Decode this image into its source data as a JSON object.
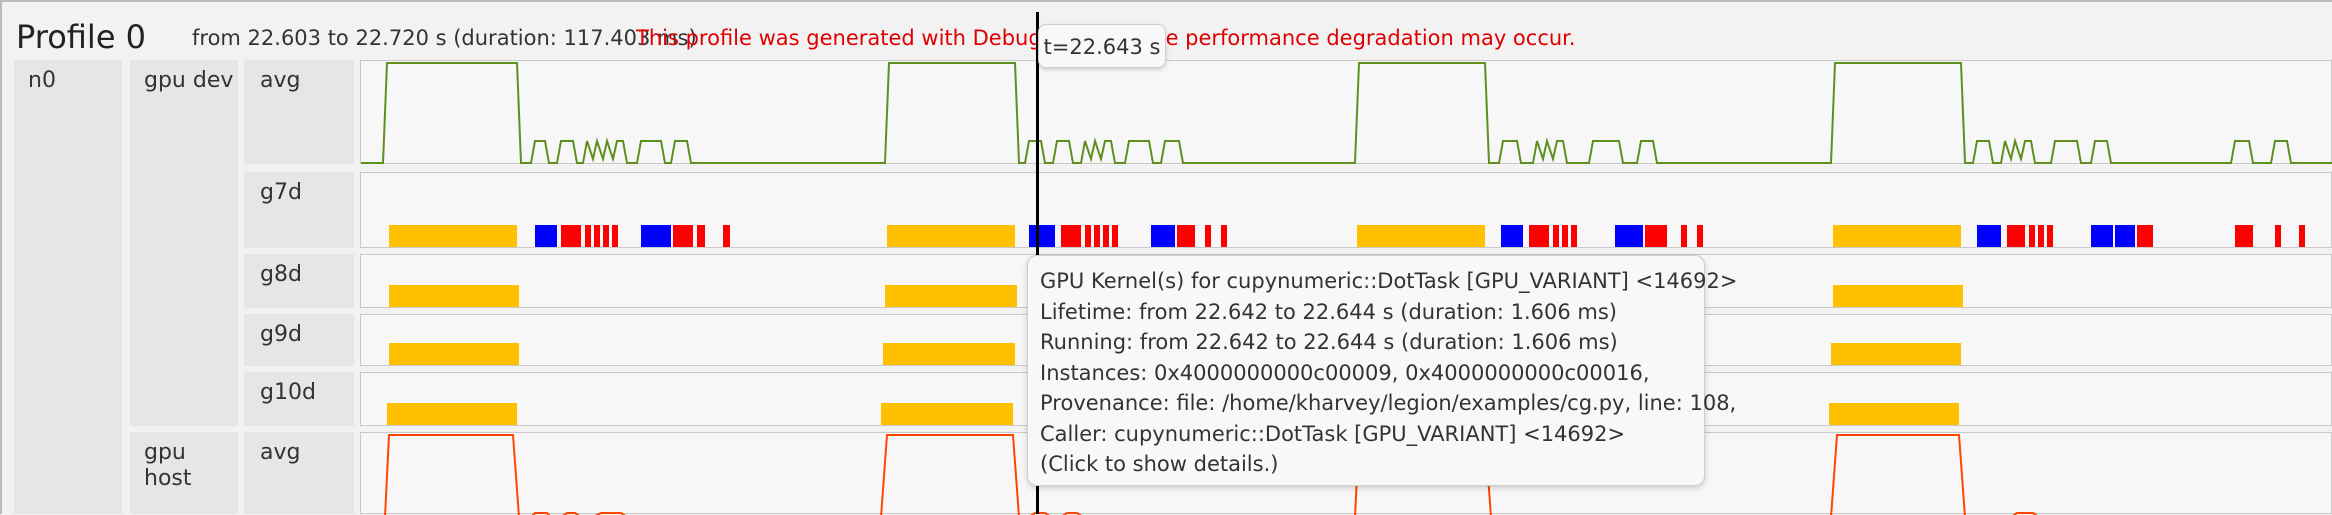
{
  "header": {
    "title": "Profile 0",
    "range": "from 22.603 to 22.720 s (duration: 117.403 ms)",
    "warning": "This profile was generated with Debug Mode. Some performance degradation may occur."
  },
  "rows": {
    "node": "n0",
    "gpu_dev": "gpu dev",
    "gpu_host": "gpu host",
    "tracks": {
      "avg_dev": "avg",
      "g7d": "g7d",
      "g8d": "g8d",
      "g9d": "g9d",
      "g10d": "g10d",
      "avg_host": "avg"
    }
  },
  "cursor": {
    "time_label": "t=22.643 s"
  },
  "tooltip": {
    "lines": [
      "GPU Kernel(s) for cupynumeric::DotTask [GPU_VARIANT] <14692>",
      "Lifetime: from 22.642 to 22.644 s (duration: 1.606 ms)",
      "Running: from 22.642 to 22.644 s (duration: 1.606 ms)",
      "Instances: 0x4000000000c00009, 0x4000000000c00016,",
      "Provenance: file: /home/kharvey/legion/examples/cg.py, line: 108,",
      "Caller: cupynumeric::DotTask [GPU_VARIANT] <14692>",
      "(Click to show details.)"
    ]
  },
  "colors": {
    "task_yellow": "#ffc000",
    "task_blue": "#0000ff",
    "task_red": "#ff0000",
    "avg_dev_line": "#5f8f1f",
    "avg_host_line": "#ff4500",
    "warning_text": "#e00000"
  }
}
